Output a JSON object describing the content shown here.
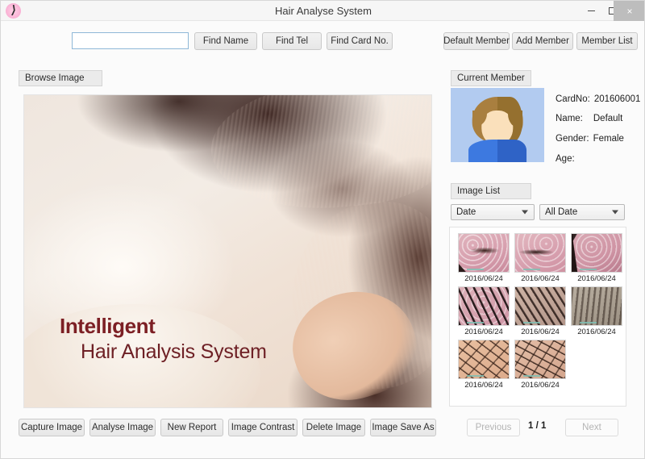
{
  "window": {
    "title": "Hair Analyse System",
    "logo_icon": "hair-logo-icon",
    "minimize_icon": "minimize-icon",
    "maximize_icon": "maximize-icon",
    "close_label": "×"
  },
  "search": {
    "value": "",
    "placeholder": "",
    "buttons": [
      {
        "label": "Find Name",
        "name": "find-name-button"
      },
      {
        "label": "Find Tel",
        "name": "find-tel-button"
      },
      {
        "label": "Find Card No.",
        "name": "find-card-no-button"
      }
    ]
  },
  "member_actions": [
    {
      "label": "Default Member",
      "name": "default-member-button"
    },
    {
      "label": "Add Member",
      "name": "add-member-button"
    },
    {
      "label": "Member List",
      "name": "member-list-button"
    }
  ],
  "browse": {
    "panel_label": "Browse Image",
    "brand_line_1": "Intelligent",
    "brand_line_2": "Hair Analysis System",
    "brand_color": "#7c1f24"
  },
  "current_member": {
    "panel_label": "Current Member",
    "avatar_icon": "member-avatar-icon",
    "fields": [
      {
        "key": "CardNo:",
        "value": "201606001"
      },
      {
        "key": "Name:",
        "value": "Default"
      },
      {
        "key": "Gender:",
        "value": "Female"
      },
      {
        "key": "Age:",
        "value": ""
      }
    ]
  },
  "image_list": {
    "panel_label": "Image List",
    "sort_select": {
      "value": "Date"
    },
    "date_select": {
      "value": "All Date"
    },
    "thumbnails": [
      {
        "date": "2016/06/24",
        "tex": "tex-a"
      },
      {
        "date": "2016/06/24",
        "tex": "tex-a2"
      },
      {
        "date": "2016/06/24",
        "tex": "tex-a3"
      },
      {
        "date": "2016/06/24",
        "tex": "tex-b"
      },
      {
        "date": "2016/06/24",
        "tex": "tex-b2"
      },
      {
        "date": "2016/06/24",
        "tex": "tex-b3"
      },
      {
        "date": "2016/06/24",
        "tex": "tex-c"
      },
      {
        "date": "2016/06/24",
        "tex": "tex-c2"
      }
    ]
  },
  "bottom_bar": {
    "buttons": [
      {
        "label": "Capture Image",
        "name": "capture-image-button"
      },
      {
        "label": "Analyse Image",
        "name": "analyse-image-button"
      },
      {
        "label": "New Report",
        "name": "new-report-button"
      },
      {
        "label": "Image Contrast",
        "name": "image-contrast-button"
      },
      {
        "label": "Delete Image",
        "name": "delete-image-button"
      },
      {
        "label": "Image Save As",
        "name": "image-save-as-button"
      }
    ],
    "previous_label": "Previous",
    "next_label": "Next",
    "page_indicator": "1 / 1"
  }
}
